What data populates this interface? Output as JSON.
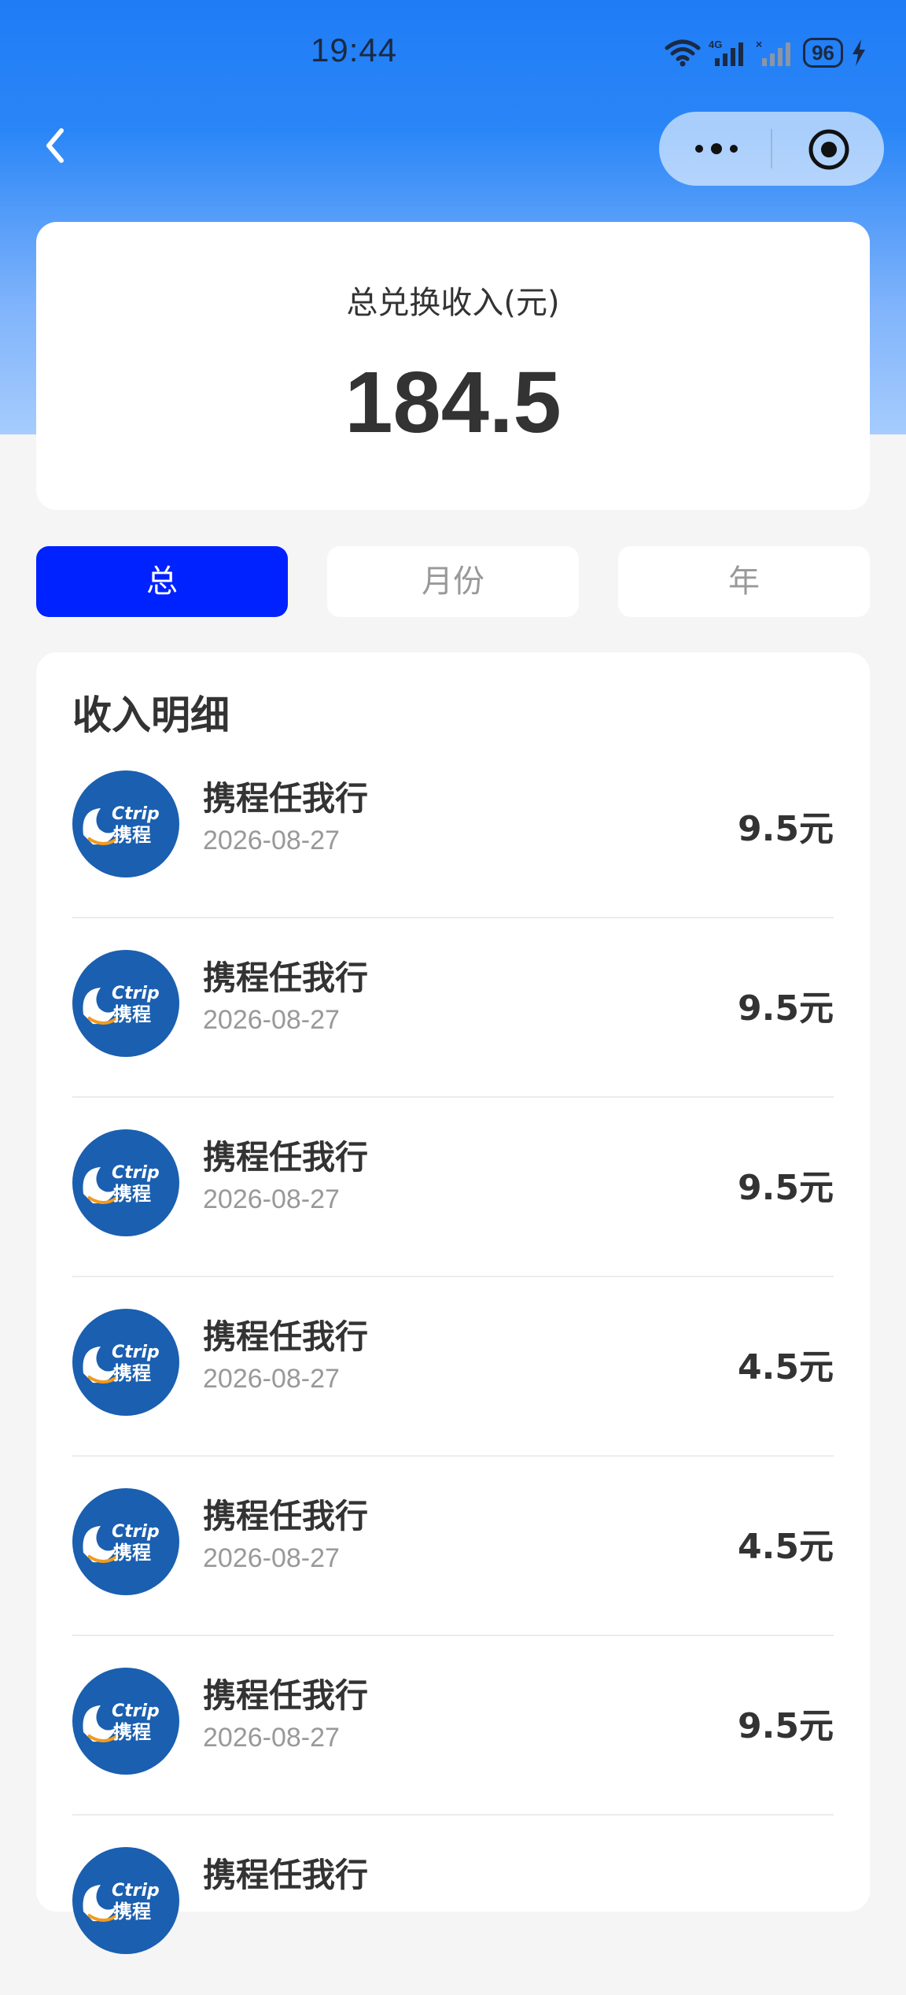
{
  "status_bar": {
    "time": "19:44",
    "battery": "96"
  },
  "summary": {
    "label": "总兑换收入(元)",
    "value": "184.5"
  },
  "tabs": [
    {
      "label": "总",
      "active": true
    },
    {
      "label": "月份",
      "active": false
    },
    {
      "label": "年",
      "active": false
    }
  ],
  "detail": {
    "title": "收入明细",
    "items": [
      {
        "name": "携程任我行",
        "date": "2026-08-27",
        "amount": "9.5元",
        "logo": "ctrip-logo"
      },
      {
        "name": "携程任我行",
        "date": "2026-08-27",
        "amount": "9.5元",
        "logo": "ctrip-logo"
      },
      {
        "name": "携程任我行",
        "date": "2026-08-27",
        "amount": "9.5元",
        "logo": "ctrip-logo"
      },
      {
        "name": "携程任我行",
        "date": "2026-08-27",
        "amount": "4.5元",
        "logo": "ctrip-logo"
      },
      {
        "name": "携程任我行",
        "date": "2026-08-27",
        "amount": "4.5元",
        "logo": "ctrip-logo"
      },
      {
        "name": "携程任我行",
        "date": "2026-08-27",
        "amount": "9.5元",
        "logo": "ctrip-logo"
      },
      {
        "name": "携程任我行",
        "date": "",
        "amount": "",
        "logo": "ctrip-logo"
      }
    ]
  },
  "colors": {
    "accent": "#0022ff",
    "header": "#1f7cf5",
    "logo_blue": "#1a5fb0"
  }
}
